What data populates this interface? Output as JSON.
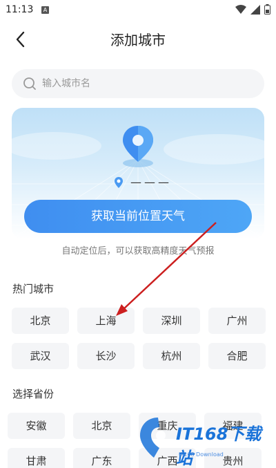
{
  "status_bar": {
    "time": "11:13",
    "notif_letter": "A"
  },
  "header": {
    "title": "添加城市"
  },
  "search": {
    "placeholder": "输入城市名"
  },
  "location_card": {
    "placeholder": "———",
    "button_label": "获取当前位置天气",
    "hint": "自动定位后，可以获取高精度天气预报"
  },
  "hot_cities": {
    "title": "热门城市",
    "items": [
      "北京",
      "上海",
      "深圳",
      "广州",
      "武汉",
      "长沙",
      "杭州",
      "合肥"
    ]
  },
  "provinces": {
    "title": "选择省份",
    "items": [
      "安徽",
      "北京",
      "重庆",
      "福建",
      "甘肃",
      "广东",
      "广西",
      "贵州"
    ]
  },
  "watermark": {
    "brand": "IT168下载站",
    "sub": "IT168 Download"
  },
  "colors": {
    "accent": "#4a9af2",
    "arrow": "#cc1f1f",
    "chip_bg": "#f4f5f7"
  }
}
